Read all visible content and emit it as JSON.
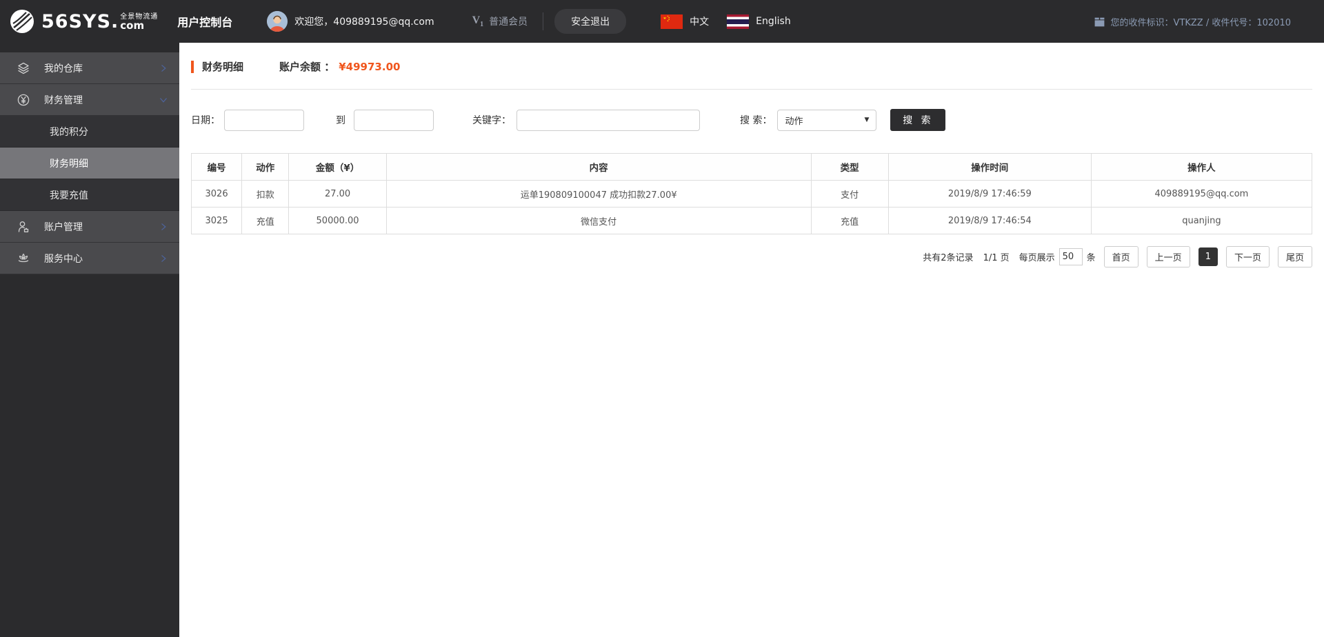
{
  "header": {
    "brand": "56SYS.",
    "brand_tagline": "全景物流通",
    "brand_suffix": "com",
    "console_title": "用户控制台",
    "welcome": "欢迎您，409889195@qq.com",
    "member_badge": "V",
    "member_badge_level": "1",
    "member_level": "普通会员",
    "logout_label": "安全退出",
    "lang_zh": "中文",
    "lang_en": "English",
    "receiver_info": "您的收件标识：VTKZZ / 收件代号：102010"
  },
  "sidebar": {
    "items": [
      {
        "label": "我的仓库",
        "icon": "warehouse-icon",
        "chevron": "right"
      },
      {
        "label": "财务管理",
        "icon": "finance-icon",
        "chevron": "down"
      },
      {
        "label": "我的积分",
        "type": "sub"
      },
      {
        "label": "财务明细",
        "type": "sub",
        "active": true
      },
      {
        "label": "我要充值",
        "type": "sub"
      },
      {
        "label": "账户管理",
        "icon": "account-icon",
        "chevron": "right"
      },
      {
        "label": "服务中心",
        "icon": "service-icon",
        "chevron": "right"
      }
    ]
  },
  "page": {
    "title": "财务明细",
    "balance_label": "账户余额 ：",
    "balance_value": "¥49973.00"
  },
  "search": {
    "date_label": "日期：",
    "to_label": "到",
    "keyword_label": "关键字：",
    "search_by_label": "搜 索：",
    "action_select_value": "动作",
    "select_caret": "▼",
    "search_button": "搜 索"
  },
  "table": {
    "headers": [
      "编号",
      "动作",
      "金额（¥）",
      "内容",
      "类型",
      "操作时间",
      "操作人"
    ],
    "rows": [
      [
        "3026",
        "扣款",
        "27.00",
        "运单190809100047 成功扣款27.00¥",
        "支付",
        "2019/8/9 17:46:59",
        "409889195@qq.com"
      ],
      [
        "3025",
        "充值",
        "50000.00",
        "微信支付",
        "充值",
        "2019/8/9 17:46:54",
        "quanjing"
      ]
    ]
  },
  "pagination": {
    "total_text": "共有2条记录",
    "page_text": "1/1 页",
    "per_page_label": "每页展示",
    "per_page_value": "50",
    "unit_label": "条",
    "first": "首页",
    "prev": "上一页",
    "current": "1",
    "next": "下一页",
    "last": "尾页"
  },
  "colors": {
    "accent_orange": "#f0561d",
    "header_bg": "#2b2b2d",
    "sidebar_row_bg": "#4a4a4d",
    "sidebar_sub_bg": "#323235",
    "sidebar_active_bg": "#76767a",
    "chevron_blue": "#4d639c",
    "receiver_text": "#8b9bb4",
    "flag_cn_red": "#df2910",
    "flag_th_blue": "#241d4f",
    "flag_th_red": "#a51931"
  }
}
